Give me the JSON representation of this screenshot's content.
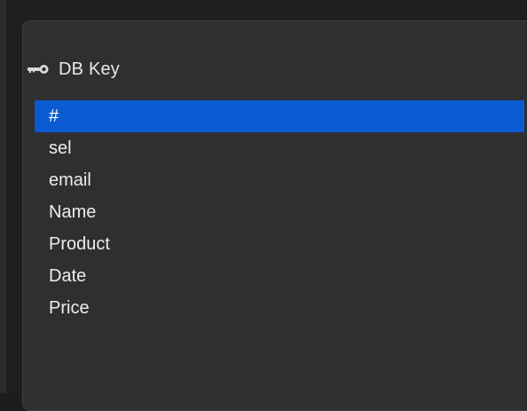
{
  "panel": {
    "header": {
      "icon": "key-icon",
      "title": "DB Key"
    },
    "fields": [
      {
        "label": "#",
        "selected": true
      },
      {
        "label": "sel",
        "selected": false
      },
      {
        "label": "email",
        "selected": false
      },
      {
        "label": "Name",
        "selected": false
      },
      {
        "label": "Product",
        "selected": false
      },
      {
        "label": "Date",
        "selected": false
      },
      {
        "label": "Price",
        "selected": false
      }
    ]
  },
  "colors": {
    "selection": "#0a5ad1",
    "panel_background": "#2e2f2f",
    "text": "#ededed"
  }
}
